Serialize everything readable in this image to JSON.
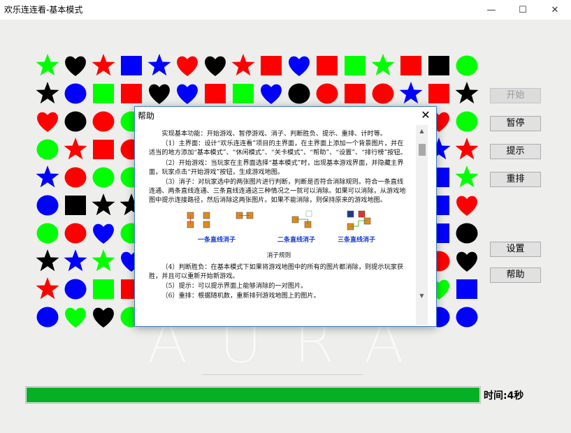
{
  "window": {
    "title": "欢乐连连看-基本模式",
    "minimize_glyph": "—",
    "maximize_glyph": "☐",
    "close_glyph": "✕"
  },
  "background": {
    "watermark": "AURA"
  },
  "colors": {
    "red": "#ff0000",
    "green": "#00ff00",
    "blue": "#0000ff",
    "black": "#000000",
    "progress": "#06b025",
    "dialog_border": "#3b7fc4",
    "caption_blue": "#1a3bd1"
  },
  "board": {
    "tiles": [
      [
        [
          "green",
          "star"
        ],
        [
          "black",
          "heart"
        ],
        [
          "red",
          "star"
        ],
        [
          "blue",
          "square"
        ],
        [
          "blue",
          "star"
        ],
        [
          "red",
          "heart"
        ],
        [
          "black",
          "heart"
        ],
        [
          "red",
          "star"
        ],
        [
          "red",
          "square"
        ],
        [
          "blue",
          "heart"
        ],
        [
          "red",
          "square"
        ],
        [
          "green",
          "square"
        ],
        [
          "green",
          "star"
        ],
        [
          "red",
          "square"
        ],
        [
          "black",
          "square"
        ],
        [
          "green",
          "circle"
        ]
      ],
      [
        [
          "black",
          "star"
        ],
        [
          "blue",
          "circle"
        ],
        [
          "green",
          "square"
        ],
        [
          "red",
          "square"
        ],
        [
          "black",
          "heart"
        ],
        [
          "blue",
          "heart"
        ],
        [
          "red",
          "square"
        ],
        [
          "green",
          "square"
        ],
        [
          "blue",
          "heart"
        ],
        [
          "black",
          "circle"
        ],
        [
          "red",
          "circle"
        ],
        [
          "red",
          "square"
        ],
        [
          "red",
          "circle"
        ],
        [
          "blue",
          "star"
        ],
        [
          "red",
          "square"
        ],
        [
          "black",
          "star"
        ]
      ],
      [
        [
          "red",
          "heart"
        ],
        [
          "black",
          "circle"
        ],
        [
          "red",
          "circle"
        ],
        [
          "green",
          "circle"
        ],
        null,
        null,
        null,
        null,
        null,
        null,
        null,
        null,
        null,
        null,
        [
          "red",
          "heart"
        ],
        [
          "green",
          "circle"
        ]
      ],
      [
        [
          "green",
          "circle"
        ],
        [
          "red",
          "star"
        ],
        [
          "red",
          "square"
        ],
        [
          "red",
          "circle"
        ],
        null,
        null,
        null,
        null,
        null,
        null,
        null,
        null,
        null,
        null,
        [
          "blue",
          "star"
        ],
        [
          "red",
          "star"
        ]
      ],
      [
        [
          "blue",
          "star"
        ],
        [
          "red",
          "circle"
        ],
        [
          "green",
          "circle"
        ],
        [
          "green",
          "circle"
        ],
        null,
        null,
        null,
        null,
        null,
        null,
        null,
        null,
        null,
        null,
        [
          "blue",
          "square"
        ],
        [
          "green",
          "star"
        ]
      ],
      [
        [
          "blue",
          "circle"
        ],
        [
          "black",
          "square"
        ],
        [
          "black",
          "star"
        ],
        [
          "black",
          "star"
        ],
        null,
        null,
        null,
        null,
        null,
        null,
        null,
        null,
        null,
        null,
        [
          "blue",
          "square"
        ],
        [
          "red",
          "heart"
        ]
      ],
      [
        [
          "green",
          "circle"
        ],
        [
          "red",
          "circle"
        ],
        [
          "blue",
          "heart"
        ],
        [
          "green",
          "circle"
        ],
        null,
        null,
        null,
        null,
        null,
        null,
        null,
        null,
        null,
        null,
        [
          "blue",
          "square"
        ],
        [
          "black",
          "circle"
        ]
      ],
      [
        [
          "black",
          "star"
        ],
        [
          "blue",
          "star"
        ],
        [
          "green",
          "star"
        ],
        [
          "blue",
          "heart"
        ],
        null,
        null,
        null,
        null,
        null,
        null,
        null,
        null,
        null,
        null,
        [
          "red",
          "circle"
        ],
        [
          "black",
          "heart"
        ]
      ],
      [
        [
          "red",
          "star"
        ],
        [
          "blue",
          "circle"
        ],
        [
          "green",
          "square"
        ],
        [
          "red",
          "square"
        ],
        null,
        null,
        null,
        null,
        null,
        null,
        null,
        null,
        null,
        null,
        [
          "green",
          "heart"
        ],
        [
          "blue",
          "square"
        ]
      ],
      [
        [
          "blue",
          "circle"
        ],
        [
          "green",
          "heart"
        ],
        [
          "black",
          "heart"
        ],
        [
          "green",
          "circle"
        ],
        null,
        null,
        null,
        null,
        null,
        null,
        null,
        null,
        null,
        null,
        [
          "blue",
          "circle"
        ],
        [
          "blue",
          "circle"
        ]
      ]
    ]
  },
  "buttons": {
    "start": "开始",
    "pause": "暂停",
    "hint": "提示",
    "reshuffle": "重排",
    "settings": "设置",
    "help": "帮助"
  },
  "progress": {
    "fraction": 1.0
  },
  "timer": {
    "label": "时间:4秒"
  },
  "help_dialog": {
    "title": "帮助",
    "close_glyph": "✕",
    "scroll_up_glyph": "▲",
    "scroll_down_glyph": "▼",
    "paragraphs": [
      "实现基本功能：开始游戏、暂停游戏、消子、判断胜负、提示、重排、计时等。",
      "（1）主界面：设计“欢乐连连看”项目的主界面，在主界面上添加一个背景图片，并在适当的地方添加“基本模式”、“休闲模式”、“关卡模式”、“帮助”、“设置”、“排行榜”按钮。",
      "（2）开始游戏：当玩家在主界面选择“基本模式”时，出现基本游戏界面，并隐藏主界面，玩家点击“开始游戏”按钮，生成游戏地图。",
      "（3）消子：对玩家选中的两张图片进行判断，判断是否符合消除规则。符合一条直线连通、两条直线连通、三条直线连通这三种情况之一就可以消除。如果可以消除，从游戏地图中提示连接路径，然后消除这两张图片。如果不能消除，则保持原来的游戏地图。"
    ],
    "diagram_captions": [
      "一条直线消子",
      "二条直线消子",
      "三条直线消子"
    ],
    "diagram_title": "消子规则",
    "paragraphs_after": [
      "（4）判断胜负：在基本模式下如果将游戏地图中的所有的图片都消除，则提示玩家获胜，并且可以重新开始新游戏。",
      "（5）提示：可以提示界面上能够消除的一对图片。",
      "（6）重排：根据随机数，重新排列游戏地图上的图片。"
    ]
  }
}
